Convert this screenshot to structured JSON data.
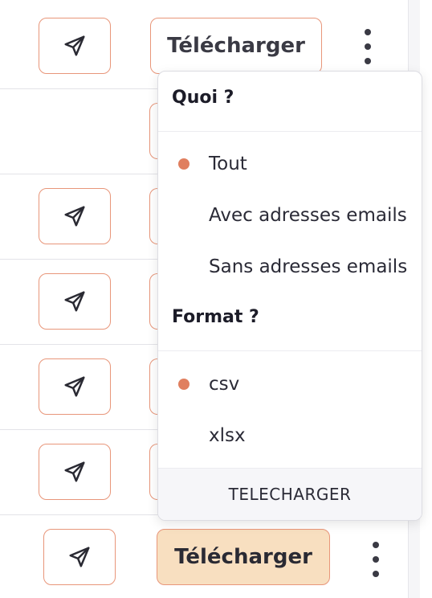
{
  "rows": {
    "download_label": "Télécharger"
  },
  "icons": {
    "send": "paper-plane-icon",
    "more": "vertical-ellipsis-icon"
  },
  "dropdown": {
    "what_heading": "Quoi ?",
    "what_options": [
      {
        "label": "Tout",
        "selected": true
      },
      {
        "label": "Avec adresses emails",
        "selected": false
      },
      {
        "label": "Sans adresses emails",
        "selected": false
      }
    ],
    "format_heading": "Format ?",
    "format_options": [
      {
        "label": "csv",
        "selected": true
      },
      {
        "label": "xlsx",
        "selected": false
      }
    ],
    "submit_label": "TELECHARGER"
  },
  "colors": {
    "accent_border": "#e8967a",
    "selected_bullet": "#e07f5f",
    "active_button_bg": "#f8dfc0"
  }
}
